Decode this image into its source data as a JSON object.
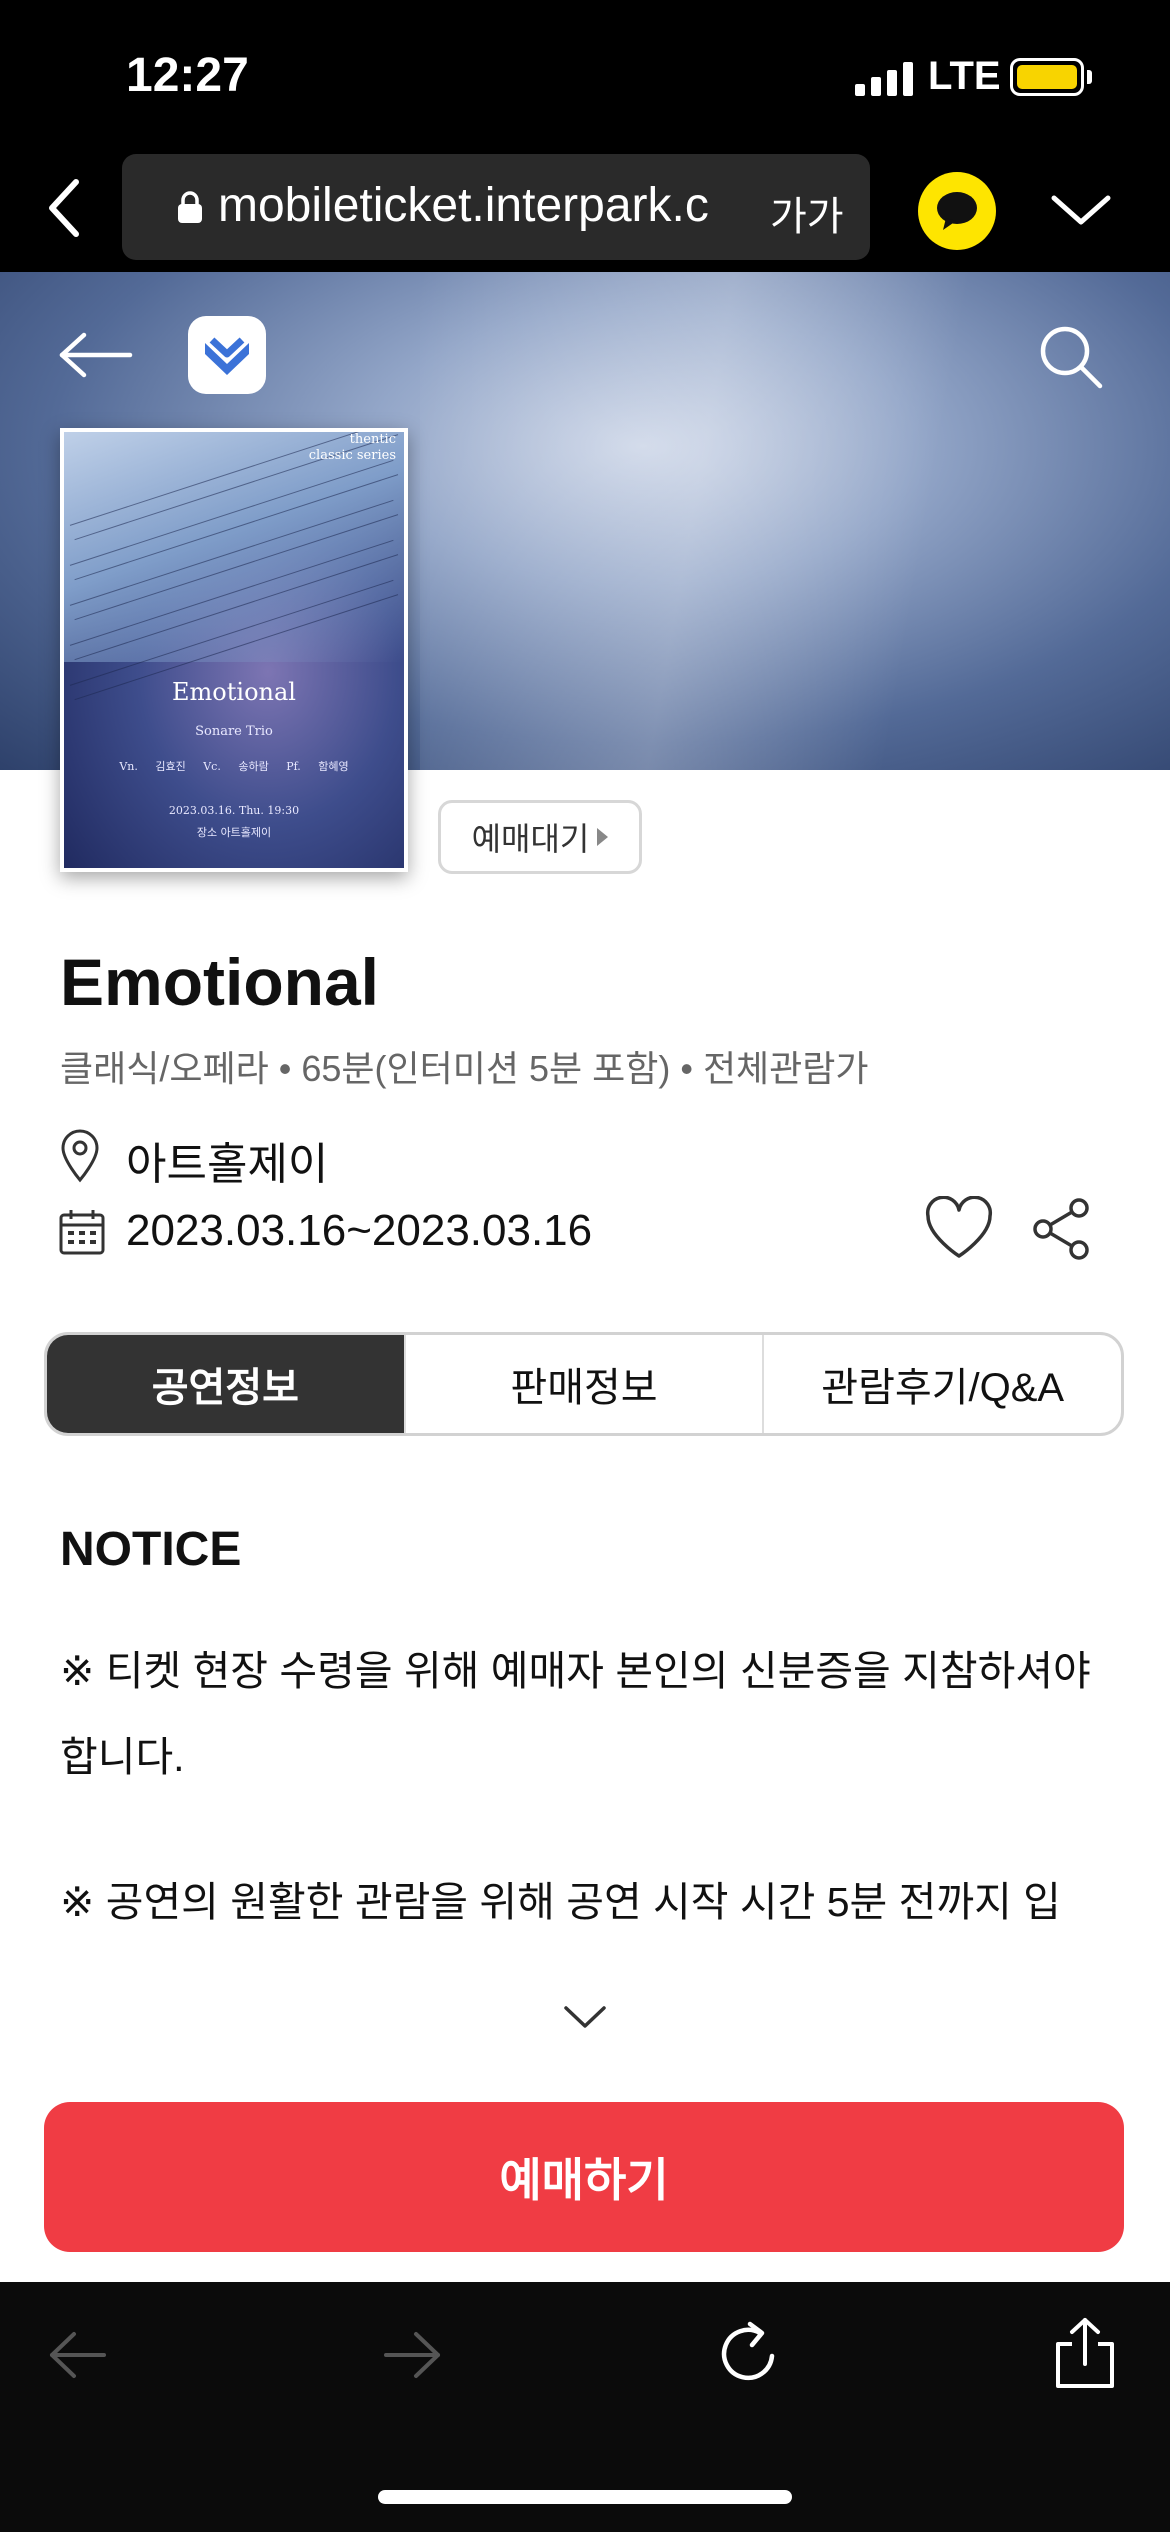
{
  "status_bar": {
    "time": "12:27",
    "network": "LTE",
    "battery_color": "#f8d400"
  },
  "browser": {
    "url": "mobileticket.interpark.c",
    "text_size_label": "가가",
    "kakao_color": "#fee500"
  },
  "icons": {
    "browser_back": "chevron-left-icon",
    "lock": "lock-icon",
    "kakao": "kakao-talk-icon",
    "browser_menu": "chevron-down-icon",
    "nav_back": "arrow-left-icon",
    "app_logo": "interpark-logo-icon",
    "nav_search": "search-icon",
    "venue": "location-pin-icon",
    "date": "calendar-icon",
    "like": "heart-icon",
    "share": "share-icon",
    "expand": "chevron-down-icon",
    "toolbar_back": "arrow-left-icon",
    "toolbar_forward": "arrow-right-icon",
    "toolbar_reload": "reload-icon",
    "toolbar_share": "share-upload-icon"
  },
  "poster": {
    "series": "thentic",
    "series_sub": "classic series",
    "title": "Emotional",
    "ensemble": "Sonare Trio",
    "players": "Vn. 김효진 Vc. 송하람 Pf. 함혜영",
    "date": "2023.03.16. Thu. 19:30",
    "venue": "장소 아트홀제이"
  },
  "sale_status": "예매대기",
  "event": {
    "title": "Emotional",
    "meta": "클래식/오페라 • 65분(인터미션 5분 포함) • 전체관람가",
    "venue": "아트홀제이",
    "dates": "2023.03.16~2023.03.16"
  },
  "tabs": [
    {
      "label": "공연정보",
      "active": true
    },
    {
      "label": "판매정보",
      "active": false
    },
    {
      "label": "관람후기/Q&A",
      "active": false
    }
  ],
  "notice": {
    "heading": "NOTICE",
    "line1": "※ 티켓 현장 수령을 위해 예매자 본인의 신분증을 지참하셔야 합니다.",
    "line2": "※ 공연의 원활한 관람을 위해 공연 시작 시간 5분 전까지 입"
  },
  "cta": {
    "label": "예매하기",
    "color": "#f03c44"
  }
}
